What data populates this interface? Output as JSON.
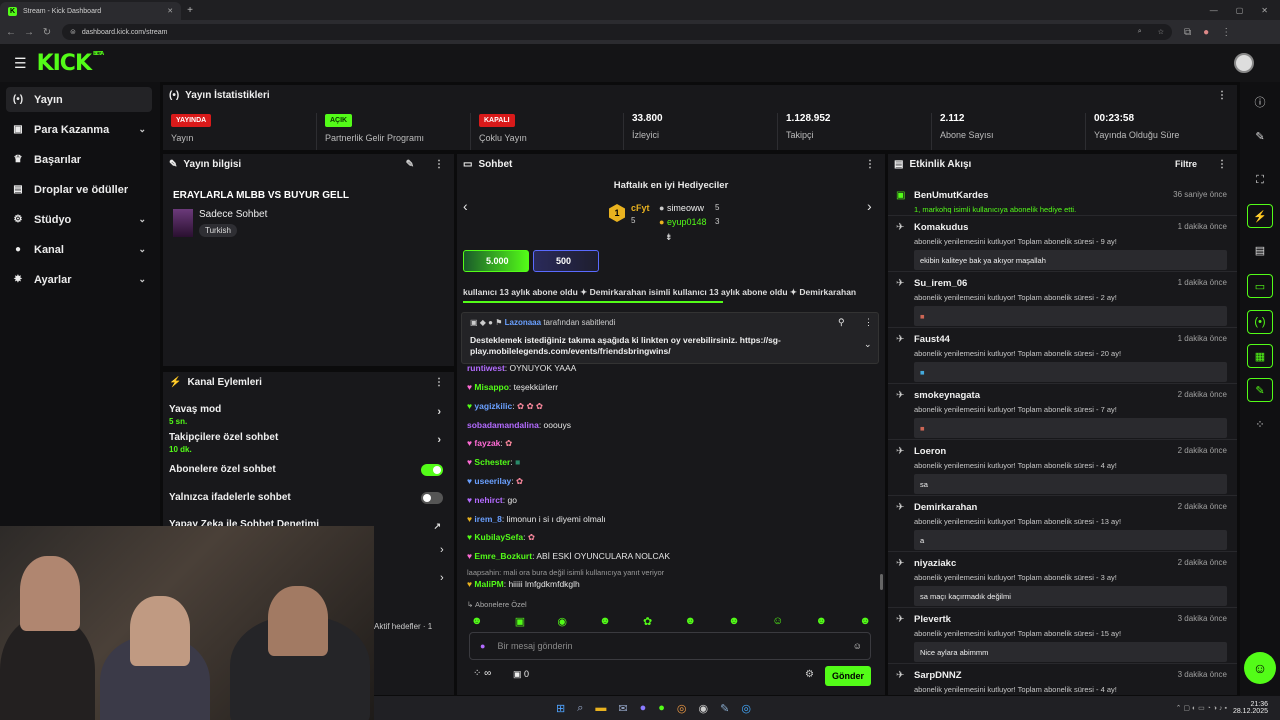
{
  "browser": {
    "tab_title": "Stream - Kick Dashboard",
    "tab_favicon": "K",
    "new_tab": "+",
    "url": "dashboard.kick.com/stream"
  },
  "topbar": {
    "logo": "KICK",
    "logo_beta": "BETA"
  },
  "sidebar": {
    "items": [
      {
        "label": "Yayın",
        "icon": "broadcast-icon",
        "glyph": "(•)"
      },
      {
        "label": "Para Kazanma",
        "icon": "wallet-icon",
        "glyph": "▣"
      },
      {
        "label": "Başarılar",
        "icon": "trophy-icon",
        "glyph": "♛"
      },
      {
        "label": "Droplar ve ödüller",
        "icon": "gift-icon",
        "glyph": "▤"
      },
      {
        "label": "Stüdyo",
        "icon": "gear-icon",
        "glyph": "⚙"
      },
      {
        "label": "Kanal",
        "icon": "person-icon",
        "glyph": "●"
      },
      {
        "label": "Ayarlar",
        "icon": "settings-icon",
        "glyph": "✸"
      }
    ]
  },
  "stats": {
    "title": "Yayın İstatistikleri",
    "cards": [
      {
        "badge": "YAYINDA",
        "label": "Yayın"
      },
      {
        "badge": "AÇIK",
        "label": "Partnerlik Gelir Programı"
      },
      {
        "badge": "KAPALI",
        "label": "Çoklu Yayın"
      },
      {
        "value": "33.800",
        "label": "İzleyici"
      },
      {
        "value": "1.128.952",
        "label": "Takipçi"
      },
      {
        "value": "2.112",
        "label": "Abone Sayısı"
      },
      {
        "value": "00:23:58",
        "label": "Yayında Olduğu Süre"
      }
    ]
  },
  "stream_info": {
    "header": "Yayın bilgisi",
    "title": "ERAYLARLA MLBB VS BUYUR GELL",
    "category": "Sadece Sohbet",
    "tag": "Turkish"
  },
  "channel_actions": {
    "header": "Kanal Eylemleri",
    "slow_mode": "Yavaş mod",
    "slow_mode_value": "5 sn.",
    "followers_only": "Takipçilere özel sohbet",
    "followers_only_value": "10 dk.",
    "subs_only": "Abonelere özel sohbet",
    "emotes_only": "Yalnızca ifadelerle sohbet",
    "ai_moderation": "Yapay Zeka ile Sohbet Denetimi",
    "active_goals": "Aktif hedefler · 1"
  },
  "chat": {
    "header": "Sohbet",
    "gifters_title": "Haftalık en iyi Hediyeciler",
    "gifters": [
      {
        "name": "cFyt",
        "count": "5"
      },
      {
        "name": "simeoww",
        "count": "5"
      },
      {
        "name": "eyup0148",
        "count": "3"
      }
    ],
    "goal1": "5.000",
    "goal2": "500",
    "ticker": "kullanıcı 13 aylık abone oldu ✦ Demirkarahan isimli kullanıcı 13 aylık abone oldu ✦ Demirkarahan",
    "pinned_by": "Lazonaaa",
    "pinned_suffix": "tarafından sabitlendi",
    "pinned_text": "Desteklemek istediğiniz takıma aşağıda ki linkten oy verebilirsiniz. https://sg-play.mobilelegends.com/events/friendsbringwins/",
    "messages": [
      {
        "user": "runtiwest",
        "text": "OYNUYOK YAAA",
        "color": "#b36bff"
      },
      {
        "user": "Misappo",
        "text": "teşekkürlerr",
        "color": "#53fc18"
      },
      {
        "user": "yagizkilic",
        "text": "",
        "color": "#6aa0ff"
      },
      {
        "user": "sobadamandalina",
        "text": "ooouys",
        "color": "#b36bff"
      },
      {
        "user": "fayzak",
        "text": "",
        "color": "#ff6bd5"
      },
      {
        "user": "Schester",
        "text": "",
        "color": "#53fc18"
      },
      {
        "user": "useerilay",
        "text": "",
        "color": "#6aa0ff"
      },
      {
        "user": "nehirct",
        "text": "go",
        "color": "#b36bff"
      },
      {
        "user": "irem_8",
        "text": "limonun i si ı diyemi olmalı",
        "color": "#6aa0ff"
      },
      {
        "user": "KubilaySefa",
        "text": "",
        "color": "#53fc18"
      },
      {
        "user": "Emre_Bozkurt",
        "text": "ABİ ESKİ OYUNCULARA NOLCAK",
        "color": "#53fc18"
      }
    ],
    "reply_note": "laapsahin: mali ora bura değil isimli kullanıcıya yanıt veriyor",
    "last_user": "MaliPM",
    "last_text": "hiiiii lmfgdkmfdkglh",
    "subs_only_label": "Abonelere Özel",
    "input_placeholder": "Bir mesaj gönderin",
    "infinity": "∞",
    "count": "0",
    "send": "Gönder"
  },
  "activity": {
    "header": "Etkinlik Akışı",
    "filter": "Filtre",
    "items": [
      {
        "name": "BenUmutKardes",
        "time": "36 saniye önce",
        "desc": "1, markohq isimli kullanıcıya abonelik hediye etti.",
        "msg": ""
      },
      {
        "name": "Komakudus",
        "time": "1 dakika önce",
        "desc": "abonelik yenilemesini kutluyor! Toplam abonelik süresi - 9 ay!",
        "msg": "ekibin kaliteye bak ya akıyor maşallah"
      },
      {
        "name": "Su_irem_06",
        "time": "1 dakika önce",
        "desc": "abonelik yenilemesini kutluyor! Toplam abonelik süresi - 2 ay!",
        "msg": ""
      },
      {
        "name": "Faust44",
        "time": "1 dakika önce",
        "desc": "abonelik yenilemesini kutluyor! Toplam abonelik süresi - 20 ay!",
        "msg": ""
      },
      {
        "name": "smokeynagata",
        "time": "2 dakika önce",
        "desc": "abonelik yenilemesini kutluyor! Toplam abonelik süresi - 7 ay!",
        "msg": ""
      },
      {
        "name": "Loeron",
        "time": "2 dakika önce",
        "desc": "abonelik yenilemesini kutluyor! Toplam abonelik süresi - 4 ay!",
        "msg": "sa"
      },
      {
        "name": "Demirkarahan",
        "time": "2 dakika önce",
        "desc": "abonelik yenilemesini kutluyor! Toplam abonelik süresi - 13 ay!",
        "msg": "a"
      },
      {
        "name": "niyaziakc",
        "time": "2 dakika önce",
        "desc": "abonelik yenilemesini kutluyor! Toplam abonelik süresi - 3 ay!",
        "msg": "sa maçı kaçırmadık değilmi"
      },
      {
        "name": "Plevertk",
        "time": "3 dakika önce",
        "desc": "abonelik yenilemesini kutluyor! Toplam abonelik süresi - 15 ay!",
        "msg": "Nice aylara abimmm"
      },
      {
        "name": "SarpDNNZ",
        "time": "3 dakika önce",
        "desc": "abonelik yenilemesini kutluyor! Toplam abonelik süresi - 4 ay!",
        "msg": ""
      }
    ]
  },
  "taskbar": {
    "time": "21:36",
    "date": "28.12.2025"
  },
  "colors": {
    "accent": "#53fc18",
    "live_red": "#d91a1a"
  }
}
